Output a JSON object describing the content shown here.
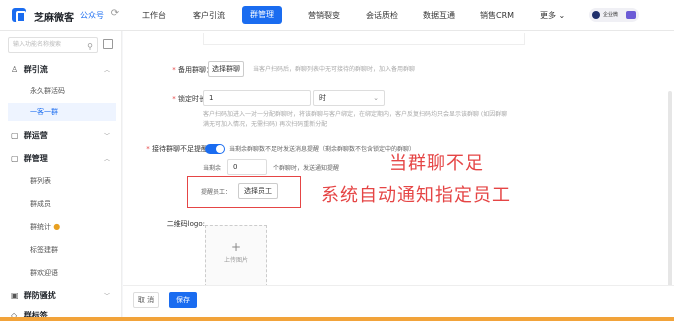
{
  "topbar": {
    "brand": "芝麻微客",
    "gzh": "公众号",
    "nav": [
      "工作台",
      "客户引流",
      "群管理",
      "营销裂变",
      "会话质检",
      "数据互通",
      "销售CRM",
      "更多"
    ],
    "active_nav": "群管理",
    "corp_label": "企业微"
  },
  "sidebar": {
    "search_placeholder": "输入功能名称搜索",
    "groups": [
      {
        "label": "群引流",
        "items": [
          "永久群活码",
          "一客一群"
        ]
      },
      {
        "label": "群运营",
        "items": []
      },
      {
        "label": "群管理",
        "items": [
          "群列表",
          "群成员",
          "群统计",
          "标签建群",
          "群欢迎语"
        ]
      },
      {
        "label": "群防骚扰",
        "items": []
      },
      {
        "label": "群标签",
        "items": []
      }
    ],
    "active_item": "一客一群"
  },
  "form": {
    "backup_label": "备用群聊：",
    "backup_button": "选择群聊",
    "backup_hint": "当客户扫码后，群聊列表中无可接待的群聊时，加入备用群聊",
    "lock_label": "锁定时长：",
    "lock_value": "1",
    "lock_unit": "时",
    "lock_hint_1": "客户扫码加进入一对一分配群聊时，将该群聊与客户绑定，在绑定期内，客户反复扫码均只会显示该群聊 (如因群聊",
    "lock_hint_2": "满无可加入情况，无需扫码) 再次扫码重新分配",
    "remind_label": "接待群聊不足提醒：",
    "remind_desc": "当剩余群聊数不足时发送消息提醒（剩余群聊数不包含锁定中的群聊）",
    "remain_prefix": "当剩余",
    "remain_value": "0",
    "remain_suffix": "个群聊时，发送通知提醒",
    "staff_label": "提醒员工：",
    "staff_button": "选择员工",
    "qr_label": "二维码logo:",
    "upload_plus": "+",
    "upload_label": "上传图片",
    "cancel": "取 消",
    "save": "保存"
  },
  "overlay": {
    "line1": "当群聊不足",
    "line2": "系统自动通知指定员工"
  },
  "colors": {
    "accent": "#1a6cf0",
    "overlay_red": "#e54545"
  }
}
